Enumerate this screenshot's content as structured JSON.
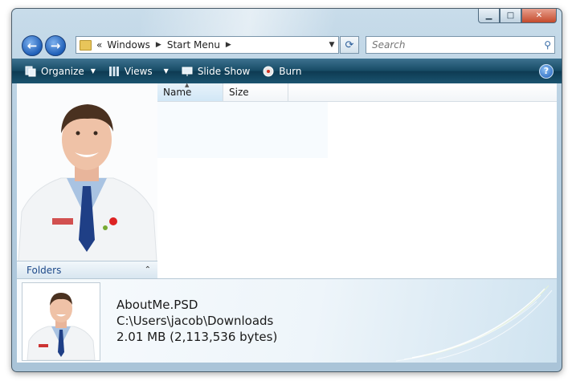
{
  "window": {
    "caption_buttons": [
      {
        "name": "minimize-button",
        "glyph": "▁"
      },
      {
        "name": "maximize-button",
        "glyph": "□"
      },
      {
        "name": "close-button",
        "glyph": "✕"
      }
    ]
  },
  "nav": {
    "back_icon": "back-arrow-icon",
    "forward_icon": "forward-arrow-icon",
    "back_glyph": "←",
    "forward_glyph": "→"
  },
  "address": {
    "overflow": "«",
    "crumbs": [
      "Windows",
      "Start Menu"
    ],
    "separator": "▶",
    "drop": "▼"
  },
  "search": {
    "placeholder": "Search",
    "glyph": "⚲"
  },
  "refresh_glyph": "⟳",
  "commands": {
    "organize": "Organize",
    "views": "Views",
    "slideshow": "Slide Show",
    "burn": "Burn",
    "dropdown_glyph": "▼",
    "help_glyph": "?"
  },
  "left_pane": {
    "folders_label": "Folders",
    "collapse_glyph": "⌃"
  },
  "columns": {
    "name": "Name",
    "size": "Size",
    "sort_glyph": "▲"
  },
  "details": {
    "filename": "AboutMe.PSD",
    "path": "C:\\Users\\jacob\\Downloads",
    "size": "2.01 MB (2,113,536 bytes)"
  }
}
